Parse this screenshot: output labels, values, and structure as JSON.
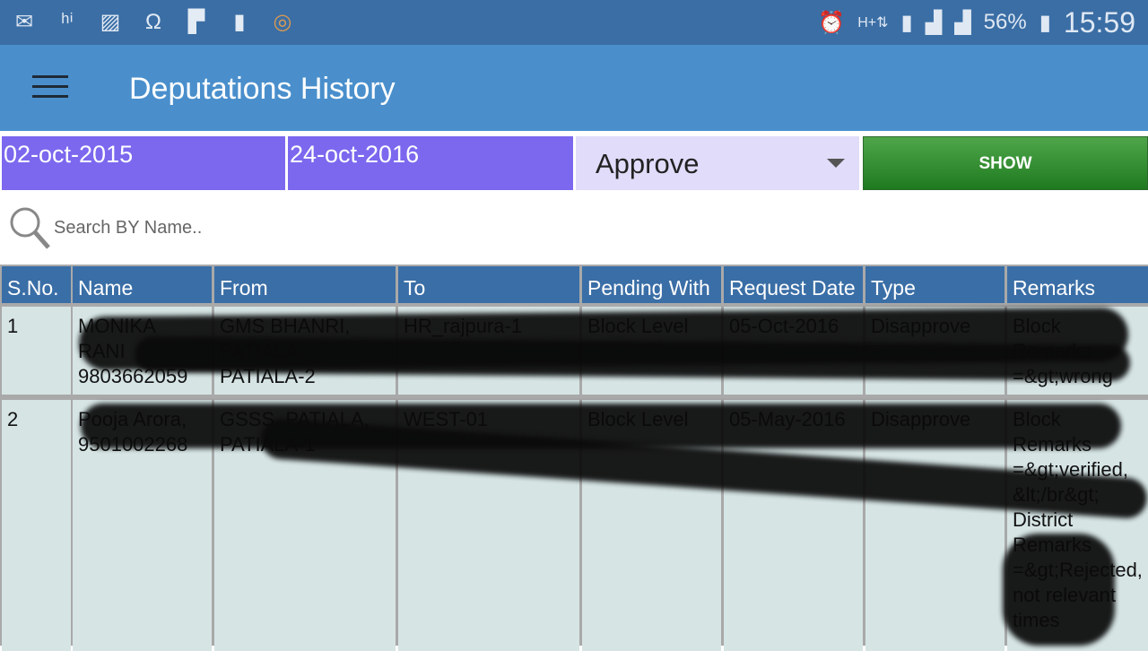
{
  "status_bar": {
    "icons": [
      "mail-icon",
      "hike-icon",
      "gallery-icon",
      "app-icon",
      "flipboard-icon",
      "sim-icon",
      "app-ring-icon"
    ],
    "right_icons": [
      "alarm-icon",
      "hplus-data-icon",
      "sim1-icon",
      "signal-icon",
      "signal-icon"
    ],
    "battery": "56%",
    "time": "15:59"
  },
  "header": {
    "title": "Deputations History"
  },
  "filters": {
    "from_date": "02-oct-2015",
    "to_date": "24-oct-2016",
    "type_selected": "Approve",
    "show_label": "SHOW"
  },
  "search": {
    "placeholder": "Search BY Name.."
  },
  "table": {
    "columns": [
      "S.No.",
      "Name",
      "From",
      "To",
      "Pending With",
      "Request Date",
      "Type",
      "Remarks"
    ],
    "rows": [
      [
        "1",
        "MONIKA RANI 9803662059",
        "GMS BHANRI, PATIALA, PATIALA-2",
        "HR_rajpura-1",
        "Block Level",
        "05-Oct-2016",
        "Disapprove",
        "Block Remarks =&gt;wrong"
      ],
      [
        "2",
        "Pooja Arora, 9501002268",
        "GSSS, PATIALA, PATIALA-1",
        "WEST-01",
        "Block Level",
        "05-May-2016",
        "Disapprove",
        "Block Remarks =&gt;verified, &lt;/br&gt; District Remarks =&gt;Rejected, not relevant times"
      ]
    ]
  },
  "colors": {
    "status_bar": "#3b6ea5",
    "app_bar": "#4a8fcc",
    "date_bg": "#7b68ee",
    "select_bg": "#e0dcfa",
    "show_button": "#2e8b2e",
    "table_header": "#3a6ea6",
    "table_cell": "#d6e4e4"
  }
}
